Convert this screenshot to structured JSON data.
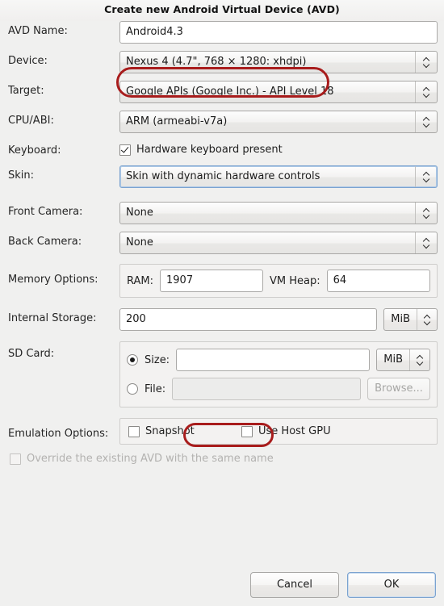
{
  "dialog": {
    "title": "Create new Android Virtual Device (AVD)"
  },
  "fields": {
    "avd_name": {
      "label": "AVD Name:",
      "value": "Android4.3",
      "placeholder": ""
    },
    "device": {
      "label": "Device:",
      "value": "Nexus 4 (4.7\", 768 × 1280: xhdpi)"
    },
    "target": {
      "label": "Target:",
      "value": "Google APIs (Google Inc.) - API Level 18"
    },
    "cpu_abi": {
      "label": "CPU/ABI:",
      "value": "ARM (armeabi-v7a)"
    },
    "keyboard": {
      "label": "Keyboard:",
      "checkbox_label": "Hardware keyboard present",
      "checked": true
    },
    "skin": {
      "label": "Skin:",
      "value": "Skin with dynamic hardware controls",
      "focused": true
    },
    "front_camera": {
      "label": "Front Camera:",
      "value": "None"
    },
    "back_camera": {
      "label": "Back Camera:",
      "value": "None"
    },
    "memory_options": {
      "label": "Memory Options:",
      "ram_label": "RAM:",
      "ram_value": "1907",
      "vm_heap_label": "VM Heap:",
      "vm_heap_value": "64"
    },
    "internal_storage": {
      "label": "Internal Storage:",
      "value": "200",
      "unit": "MiB"
    },
    "sd_card": {
      "label": "SD Card:",
      "size_label": "Size:",
      "size_value": "",
      "size_unit": "MiB",
      "size_selected": true,
      "file_label": "File:",
      "file_value": "",
      "file_selected": false,
      "browse_label": "Browse..."
    },
    "emulation_options": {
      "label": "Emulation Options:",
      "snapshot_label": "Snapshot",
      "snapshot_checked": false,
      "host_gpu_label": "Use Host GPU",
      "host_gpu_checked": false
    },
    "override": {
      "label": "Override the existing AVD with the same name",
      "checked": false,
      "enabled": false
    }
  },
  "buttons": {
    "cancel": "Cancel",
    "ok": "OK"
  },
  "annotations": {
    "color": "#a81c1c",
    "device_highlight": "device-combo",
    "sd_size_highlight": "sd-size-input"
  }
}
